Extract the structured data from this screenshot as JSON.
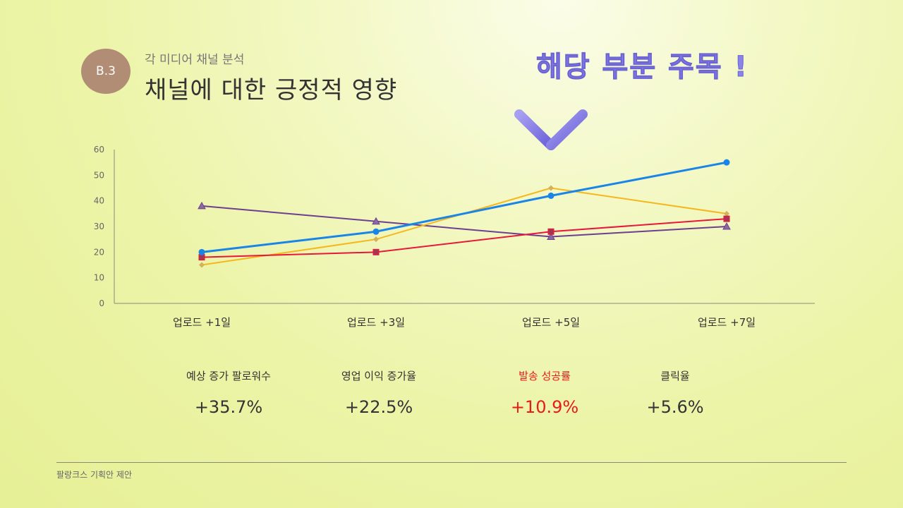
{
  "badge": "B.3",
  "subtitle": "각 미디어 채널 분석",
  "title": "채널에 대한 긍정적 영향",
  "callout": "해당 부분 주목 !",
  "chart_data": {
    "type": "line",
    "categories": [
      "업로드 +1일",
      "업로드 +3일",
      "업로드 +5일",
      "업로드 +7일"
    ],
    "ylim": [
      0,
      60
    ],
    "yticks": [
      0,
      10,
      20,
      30,
      40,
      50,
      60
    ],
    "grid": false,
    "series": [
      {
        "values": [
          38,
          32,
          26,
          30
        ],
        "color": "#6e3f8f",
        "marker": "triangle"
      },
      {
        "values": [
          15,
          25,
          45,
          35
        ],
        "color": "#f5b81c",
        "marker": "diamond"
      },
      {
        "values": [
          18,
          20,
          28,
          33
        ],
        "color": "#e8173c",
        "marker": "square"
      },
      {
        "values": [
          20,
          28,
          42,
          55
        ],
        "color": "#1a85e8",
        "marker": "circle"
      }
    ]
  },
  "kpis": [
    {
      "label": "예상 증가 팔로워수",
      "value": "+35.7%",
      "highlight": false
    },
    {
      "label": "영업 이익 증가율",
      "value": "+22.5%",
      "highlight": false
    },
    {
      "label": "발송 성공률",
      "value": "+10.9%",
      "highlight": true
    },
    {
      "label": "클릭율",
      "value": "+5.6%",
      "highlight": false
    }
  ],
  "footer": "팔랑크스 기획안 제안",
  "colors": {
    "highlight": "#e81a1a",
    "callout": "#8b83e6",
    "badge": "#b08d74"
  }
}
